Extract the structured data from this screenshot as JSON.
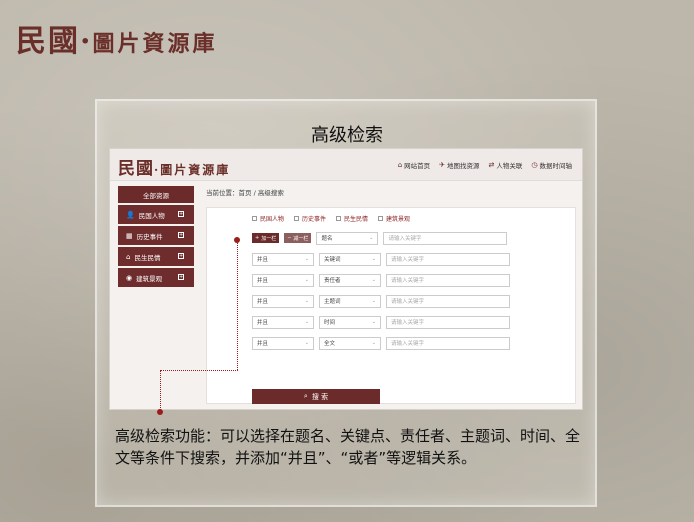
{
  "brand": {
    "main": "民國",
    "dot": "·",
    "sub": "圖片資源庫"
  },
  "slide_title": "高级检索",
  "site": {
    "logo_main": "民國",
    "logo_dot": "·",
    "logo_sub": "圖片資源庫",
    "nav": [
      "网站首页",
      "地图找资源",
      "人物关联",
      "数据时间轴"
    ]
  },
  "sidebar": {
    "head": "全部资源",
    "items": [
      "民国人物",
      "历史事件",
      "民生民情",
      "建筑景观"
    ]
  },
  "breadcrumb": "当前位置：首页 / 高级搜索",
  "filters": [
    "民国人物",
    "历史事件",
    "民生民情",
    "建筑景观"
  ],
  "search_rows": [
    {
      "logic": "",
      "field": "题名",
      "placeholder": "请输入关键字"
    },
    {
      "logic": "并且",
      "field": "关键词",
      "placeholder": "请输入关键字"
    },
    {
      "logic": "并且",
      "field": "责任者",
      "placeholder": "请输入关键字"
    },
    {
      "logic": "并且",
      "field": "主题词",
      "placeholder": "请输入关键字"
    },
    {
      "logic": "并且",
      "field": "时间",
      "placeholder": "请输入关键字"
    },
    {
      "logic": "并且",
      "field": "全文",
      "placeholder": "请输入关键字"
    }
  ],
  "add_row_label": "加一栏",
  "remove_row_label": "减一栏",
  "search_button": "搜 索",
  "description": "高级检索功能：可以选择在题名、关键点、责任者、主题词、时间、全文等条件下搜索，并添加“并且”、“或者”等逻辑关系。",
  "colors": {
    "accent": "#6b2b2b",
    "annotation": "#9b1c1c"
  }
}
